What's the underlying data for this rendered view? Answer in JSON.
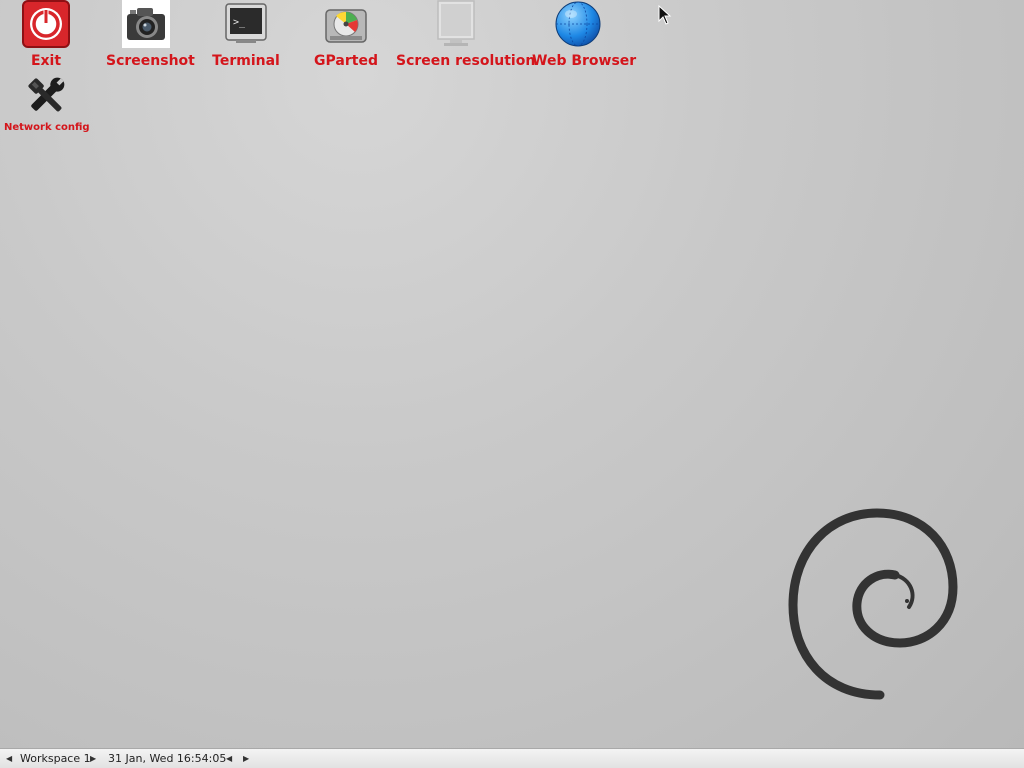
{
  "desktop": {
    "icons": [
      {
        "label": "Exit",
        "icon": "power-icon"
      },
      {
        "label": "Screenshot",
        "icon": "camera-icon"
      },
      {
        "label": "Terminal",
        "icon": "terminal-icon"
      },
      {
        "label": "GParted",
        "icon": "disk-icon"
      },
      {
        "label": "Screen resolution",
        "icon": "monitor-icon"
      },
      {
        "label": "Web Browser",
        "icon": "globe-icon"
      },
      {
        "label": "Network config",
        "icon": "tools-icon"
      }
    ],
    "wallpaper_logo": "debian-swirl-icon",
    "label_color": "#d4151b"
  },
  "taskbar": {
    "workspace": "Workspace 1",
    "clock": "31 Jan, Wed 16:54:05"
  }
}
